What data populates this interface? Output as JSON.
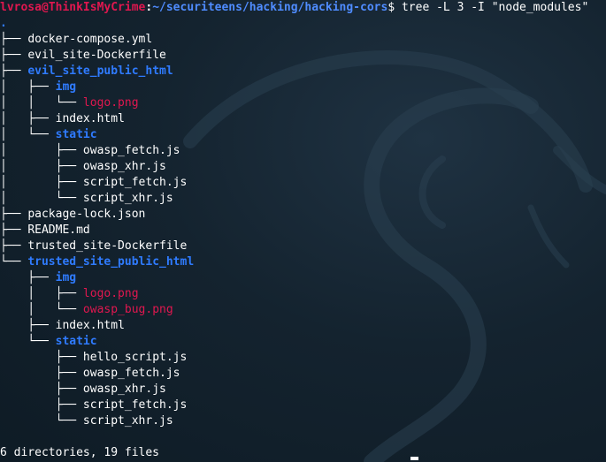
{
  "prompt": {
    "user_host": "lvrosa@ThinkIsMyCrime",
    "separator": ":",
    "path": "~/securiteens/hacking/hacking-cors",
    "command": "$ tree -L 3 -I \"node_modules\""
  },
  "tree": {
    "root": ".",
    "entries": [
      {
        "prefix": "├── ",
        "name": "docker-compose.yml",
        "type": "file"
      },
      {
        "prefix": "├── ",
        "name": "evil_site-Dockerfile",
        "type": "file"
      },
      {
        "prefix": "├── ",
        "name": "evil_site_public_html",
        "type": "dir"
      },
      {
        "prefix": "│   ├── ",
        "name": "img",
        "type": "dir"
      },
      {
        "prefix": "│   │   └── ",
        "name": "logo.png",
        "type": "png"
      },
      {
        "prefix": "│   ├── ",
        "name": "index.html",
        "type": "file"
      },
      {
        "prefix": "│   └── ",
        "name": "static",
        "type": "dir"
      },
      {
        "prefix": "│       ├── ",
        "name": "owasp_fetch.js",
        "type": "file"
      },
      {
        "prefix": "│       ├── ",
        "name": "owasp_xhr.js",
        "type": "file"
      },
      {
        "prefix": "│       ├── ",
        "name": "script_fetch.js",
        "type": "file"
      },
      {
        "prefix": "│       └── ",
        "name": "script_xhr.js",
        "type": "file"
      },
      {
        "prefix": "├── ",
        "name": "package-lock.json",
        "type": "file"
      },
      {
        "prefix": "├── ",
        "name": "README.md",
        "type": "file"
      },
      {
        "prefix": "├── ",
        "name": "trusted_site-Dockerfile",
        "type": "file"
      },
      {
        "prefix": "└── ",
        "name": "trusted_site_public_html",
        "type": "dir"
      },
      {
        "prefix": "    ├── ",
        "name": "img",
        "type": "dir"
      },
      {
        "prefix": "    │   ├── ",
        "name": "logo.png",
        "type": "png"
      },
      {
        "prefix": "    │   └── ",
        "name": "owasp_bug.png",
        "type": "png"
      },
      {
        "prefix": "    ├── ",
        "name": "index.html",
        "type": "file"
      },
      {
        "prefix": "    └── ",
        "name": "static",
        "type": "dir"
      },
      {
        "prefix": "        ├── ",
        "name": "hello_script.js",
        "type": "file"
      },
      {
        "prefix": "        ├── ",
        "name": "owasp_fetch.js",
        "type": "file"
      },
      {
        "prefix": "        ├── ",
        "name": "owasp_xhr.js",
        "type": "file"
      },
      {
        "prefix": "        ├── ",
        "name": "script_fetch.js",
        "type": "file"
      },
      {
        "prefix": "        └── ",
        "name": "script_xhr.js",
        "type": "file"
      }
    ]
  },
  "summary": "6 directories, 19 files",
  "colors": {
    "background": "#14232f",
    "user_host": "#e0174f",
    "path": "#4f8cff",
    "directory": "#2f7bff",
    "png_file": "#e0174f",
    "text": "#ffffff"
  }
}
